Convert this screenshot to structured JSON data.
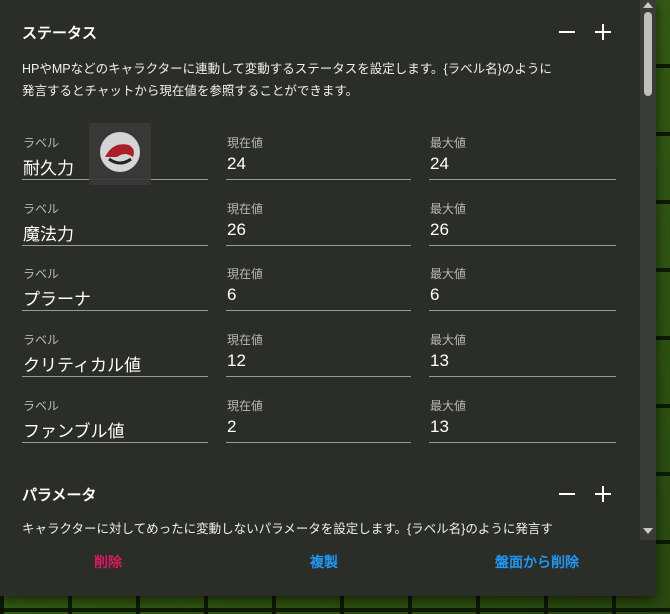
{
  "colors": {
    "danger": "#d81b60",
    "primary": "#2196f3"
  },
  "status_section": {
    "title": "ステータス",
    "description_line1": "HPやMPなどのキャラクターに連動して変動するステータスを設定します。{ラベル名}のように",
    "description_line2": "発言するとチャットから現在値を参照することができます。",
    "rows": [
      {
        "label_caption": "ラベル",
        "label": "耐久力",
        "current_caption": "現在値",
        "current": "24",
        "max_caption": "最大値",
        "max": "24"
      },
      {
        "label_caption": "ラベル",
        "label": "魔法力",
        "current_caption": "現在値",
        "current": "26",
        "max_caption": "最大値",
        "max": "26"
      },
      {
        "label_caption": "ラベル",
        "label": "プラーナ",
        "current_caption": "現在値",
        "current": "6",
        "max_caption": "最大値",
        "max": "6"
      },
      {
        "label_caption": "ラベル",
        "label": "クリティカル値",
        "current_caption": "現在値",
        "current": "12",
        "max_caption": "最大値",
        "max": "13"
      },
      {
        "label_caption": "ラベル",
        "label": "ファンブル値",
        "current_caption": "現在値",
        "current": "2",
        "max_caption": "最大値",
        "max": "13"
      }
    ]
  },
  "param_section": {
    "title": "パラメータ",
    "description_line1": "キャラクターに対してめったに変動しないパラメータを設定します。{ラベル名}のように発言す"
  },
  "footer": {
    "delete_label": "削除",
    "duplicate_label": "複製",
    "remove_from_board_label": "盤面から削除"
  }
}
